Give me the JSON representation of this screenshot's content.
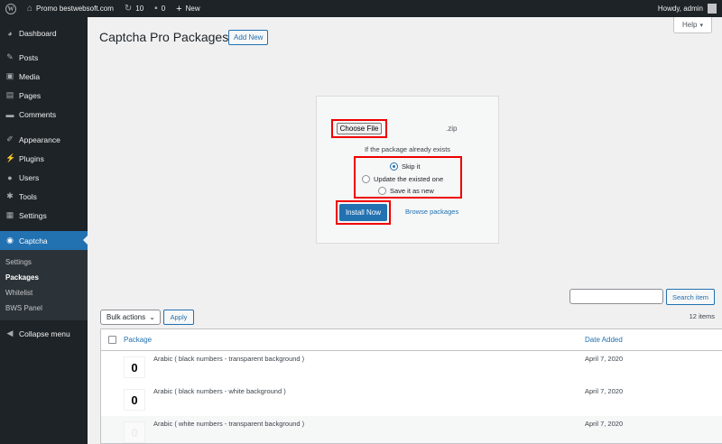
{
  "adminbar": {
    "site_name": "Promo bestwebsoft.com",
    "updates_count": "10",
    "comments_count": "0",
    "new_label": "New",
    "howdy": "Howdy, admin"
  },
  "sidebar": {
    "items": [
      {
        "label": "Dashboard",
        "icon": "dashboard-icon"
      },
      {
        "label": "Posts",
        "icon": "pin-icon"
      },
      {
        "label": "Media",
        "icon": "media-icon"
      },
      {
        "label": "Pages",
        "icon": "pages-icon"
      },
      {
        "label": "Comments",
        "icon": "comment-icon"
      },
      {
        "label": "Appearance",
        "icon": "brush-icon"
      },
      {
        "label": "Plugins",
        "icon": "plugin-icon"
      },
      {
        "label": "Users",
        "icon": "users-icon"
      },
      {
        "label": "Tools",
        "icon": "wrench-icon"
      },
      {
        "label": "Settings",
        "icon": "settings-icon"
      },
      {
        "label": "Captcha",
        "icon": "eye-icon"
      }
    ],
    "submenu": [
      "Settings",
      "Packages",
      "Whitelist",
      "BWS Panel"
    ],
    "collapse_label": "Collapse menu"
  },
  "page": {
    "title": "Captcha Pro Packages",
    "add_new": "Add New",
    "help": "Help"
  },
  "upload": {
    "choose_file": "Choose File",
    "zip_hint": ".zip",
    "exists_text": "If the package already exists",
    "options": [
      "Skip it",
      "Update the existed one",
      "Save it as new"
    ],
    "selected_option": "Skip it",
    "install_label": "Install Now",
    "browse_label": "Browse packages"
  },
  "search": {
    "button": "Search item",
    "value": ""
  },
  "bulk": {
    "selected": "Bulk actions",
    "apply": "Apply",
    "items_count": "12 items"
  },
  "table": {
    "columns": [
      "Package",
      "Date Added"
    ],
    "rows": [
      {
        "thumb": "0",
        "name": "Arabic ( black numbers - transparent background )",
        "date": "April 7, 2020"
      },
      {
        "thumb": "0",
        "name": "Arabic ( black numbers - white background )",
        "date": "April 7, 2020"
      },
      {
        "thumb": "0",
        "name": "Arabic ( white numbers - transparent background )",
        "date": "April 7, 2020"
      }
    ]
  },
  "colors": {
    "accent": "#2271b1",
    "admin_bg": "#1d2327",
    "highlight_red": "#ee0000"
  }
}
